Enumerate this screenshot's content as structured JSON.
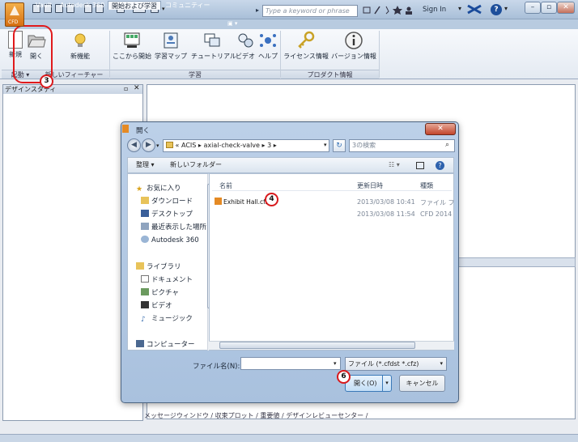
{
  "app": {
    "search_placeholder": "Type a keyword or phrase",
    "sign_in": "Sign In",
    "app_button_label": "CFD"
  },
  "tabs": [
    {
      "label": "Vault"
    },
    {
      "label": "Autodesk 360"
    },
    {
      "label": "開始および学習",
      "active": true
    },
    {
      "label": "コミュニティー"
    }
  ],
  "ribbon": {
    "buttons": {
      "new": "新規",
      "open": "開く",
      "new_features": "新機能",
      "start_here": "ここから開始",
      "learning_map": "学習マップ",
      "tutorials": "チュートリアル",
      "video": "ビデオ",
      "help": "ヘルプ",
      "license": "ライセンス情報",
      "version": "バージョン情報"
    },
    "groups": {
      "launch": "起動",
      "new_features": "新しいフィーチャー",
      "learning": "学習",
      "product_info": "プロダクト情報"
    }
  },
  "left_panel": {
    "title": "デザインスタディ"
  },
  "message_tabs": [
    "メッセージウィンドウ",
    "収束プロット",
    "重要値",
    "デザインレビューセンター"
  ],
  "badges": {
    "b3": "3",
    "b4": "4",
    "b6": "6"
  },
  "colors": {
    "accent": "#d8191c",
    "app_orange": "#e58a24",
    "dialog_frame": "#a9c1de"
  },
  "dialog": {
    "title": "開く",
    "address": {
      "prefix": "«",
      "parts": [
        "ACIS",
        "axial-check-valve",
        "3"
      ]
    },
    "search_placeholder": "3の検索",
    "toolbar": {
      "organize": "整理 ▾",
      "new_folder": "新しいフォルダー"
    },
    "nav": {
      "favorites": "お気に入り",
      "downloads": "ダウンロード",
      "desktop": "デスクトップ",
      "recent": "最近表示した場所",
      "autodesk360": "Autodesk 360",
      "libraries": "ライブラリ",
      "documents": "ドキュメント",
      "pictures": "ピクチャ",
      "videos": "ビデオ",
      "music": "ミュージック",
      "computer": "コンピューター"
    },
    "columns": {
      "name": "名前",
      "date": "更新日時",
      "type": "種類"
    },
    "files": [
      {
        "name": "Exhibit Hall.cfz",
        "date": "2013/03/08 10:41",
        "type": "ファイル フ"
      },
      {
        "name": "",
        "date": "2013/03/08 11:54",
        "type": "CFD 2014"
      }
    ],
    "filename_label": "ファイル名(N):",
    "filename_value": "",
    "filetype": "ファイル (*.cfdst *.cfz)",
    "open_button": "開く(O)",
    "cancel_button": "キャンセル"
  }
}
